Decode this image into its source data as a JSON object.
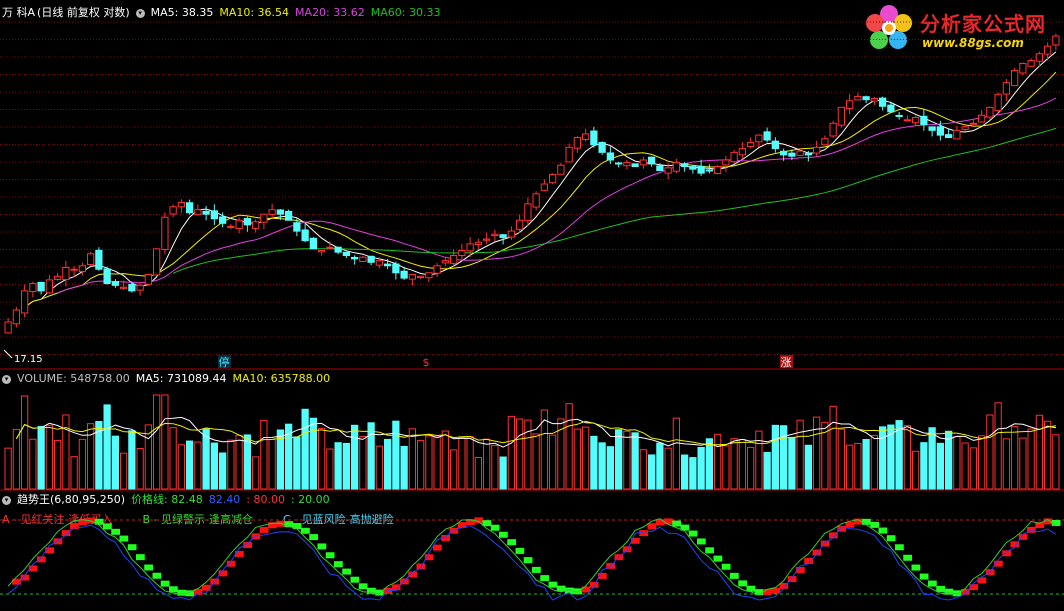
{
  "price_panel": {
    "stock_name": "万 科A",
    "period_label": "(日线 前复权 对数)",
    "ma_items": [
      {
        "label": "MA5: 38.35",
        "color": "#ffffff"
      },
      {
        "label": "MA10: 36.54",
        "color": "#f0f000"
      },
      {
        "label": "MA20: 33.62",
        "color": "#e040e0"
      },
      {
        "label": "MA60: 30.33",
        "color": "#20c020"
      }
    ],
    "low_marker": "17.15",
    "events": [
      {
        "label": "停",
        "color": "#40e0ff",
        "bg": "#003040"
      },
      {
        "label": "$",
        "color": "#ff3030",
        "bg": "#000000"
      },
      {
        "label": "涨",
        "color": "#ffffff",
        "bg": "#a01010"
      }
    ]
  },
  "volume_panel": {
    "items": [
      {
        "label": "VOLUME: 548758.00",
        "color": "#c0c0c0"
      },
      {
        "label": "MA5: 731089.44",
        "color": "#ffffff"
      },
      {
        "label": "MA10: 635788.00",
        "color": "#f0f000"
      }
    ]
  },
  "indicator_panel": {
    "name": "趋势王(6,80,95,250)",
    "items": [
      {
        "label": "价格线: 82.48",
        "color": "#30e030"
      },
      {
        "label": "82.40",
        "color": "#3060ff"
      },
      {
        "label": ": 80.00",
        "color": "#ff3030"
      },
      {
        "label": ": 20.00",
        "color": "#30e030"
      }
    ],
    "legend": [
      {
        "label": "A - 见红关注-逢低买入",
        "color": "#ff3030"
      },
      {
        "label": "B - 见绿警示-逢高减仓",
        "color": "#30e030"
      },
      {
        "label": "C - 见蓝风险-高抛避险",
        "color": "#40e0ff"
      }
    ]
  },
  "logo": {
    "title": "分析家公式网",
    "url": "www.88gs.com"
  },
  "colors": {
    "up": "#ff3030",
    "down": "#54fcfc",
    "grid": "#8b0000",
    "background": "#000000"
  },
  "chart_data": {
    "type": "candlestick",
    "closes": [
      17.6,
      18.2,
      19.2,
      19.6,
      19.2,
      19.8,
      20.0,
      20.5,
      20.4,
      20.6,
      21.3,
      20.4,
      19.6,
      19.5,
      19.4,
      19.2,
      19.5,
      20.1,
      21.6,
      23.6,
      24.3,
      24.6,
      23.9,
      24.1,
      23.8,
      23.5,
      23.2,
      23.0,
      23.4,
      23.1,
      23.3,
      23.8,
      24.1,
      23.8,
      23.4,
      22.7,
      22.1,
      21.6,
      21.5,
      21.7,
      21.4,
      21.2,
      21.0,
      21.1,
      20.8,
      20.9,
      20.6,
      20.2,
      19.9,
      20.1,
      20.0,
      20.2,
      20.6,
      20.9,
      21.2,
      21.5,
      21.9,
      22.0,
      22.2,
      22.5,
      22.3,
      22.7,
      23.4,
      24.5,
      25.2,
      25.9,
      26.6,
      27.3,
      28.7,
      29.5,
      29.8,
      28.9,
      28.3,
      27.7,
      27.4,
      27.5,
      27.2,
      27.7,
      27.4,
      26.9,
      27.1,
      27.5,
      27.2,
      27.0,
      26.7,
      26.9,
      27.2,
      27.7,
      28.3,
      28.6,
      29.1,
      29.7,
      29.3,
      28.6,
      28.1,
      28.0,
      28.4,
      28.1,
      28.7,
      29.4,
      30.7,
      32.1,
      32.7,
      33.1,
      32.8,
      32.9,
      32.2,
      31.7,
      31.3,
      31.0,
      31.2,
      30.6,
      30.1,
      29.7,
      29.5,
      30.1,
      30.4,
      30.7,
      31.4,
      32.1,
      33.3,
      34.4,
      35.6,
      36.3,
      36.6,
      37.3,
      38.1,
      39.2
    ],
    "ma5_last": 38.35,
    "ma10_last": 36.54,
    "ma20_last": 33.62,
    "ma60_last": 30.33
  }
}
